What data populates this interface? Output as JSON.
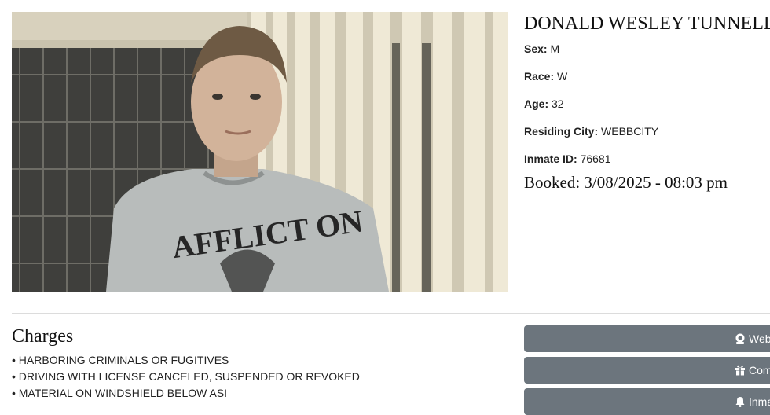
{
  "inmate": {
    "name": "DONALD WESLEY TUNNELL",
    "sex_label": "Sex:",
    "sex": "M",
    "race_label": "Race:",
    "race": "W",
    "age_label": "Age:",
    "age": "32",
    "city_label": "Residing City:",
    "city": "WEBBCITY",
    "id_label": "Inmate ID:",
    "id": "76681",
    "booked": "Booked: 3/08/2025 - 08:03 pm"
  },
  "charges": {
    "title": "Charges",
    "items": [
      "• HARBORING CRIMINALS OR FUGITIVES",
      "• DRIVING WITH LICENSE CANCELED, SUSPENDED OR REVOKED",
      "• MATERIAL ON WINDSHIELD BELOW ASI"
    ]
  },
  "buttons": [
    {
      "label": "Web",
      "icon": "webcam-icon"
    },
    {
      "label": "Com",
      "icon": "gift-icon"
    },
    {
      "label": "Inmate N",
      "icon": "bell-icon"
    }
  ],
  "photo": {
    "shirt_text": "AFFLICT ON"
  }
}
